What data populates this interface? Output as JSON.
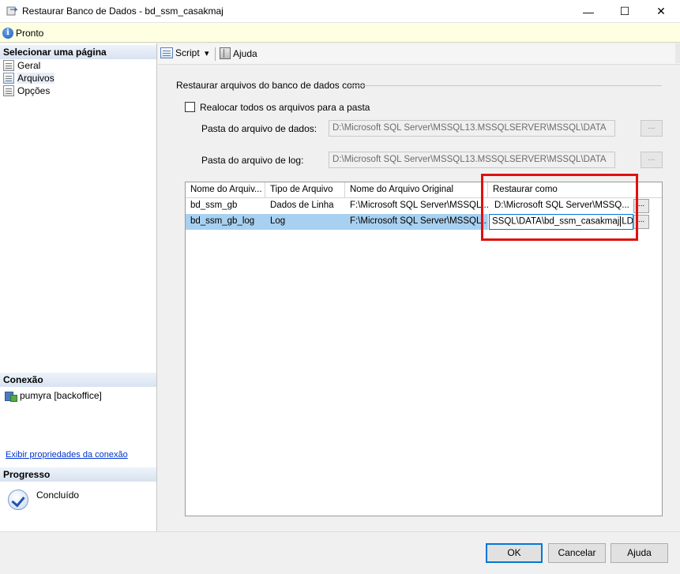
{
  "window": {
    "title": "Restaurar Banco de Dados - bd_ssm_casakmaj",
    "minimize": "—",
    "maximize": "☐",
    "close": "✕"
  },
  "status": {
    "text": "Pronto"
  },
  "sidebar": {
    "select_page_header": "Selecionar uma página",
    "items": [
      {
        "label": "Geral"
      },
      {
        "label": "Arquivos"
      },
      {
        "label": "Opções"
      }
    ],
    "connection_header": "Conexão",
    "connection_name": "pumyra [backoffice]",
    "connection_link": "Exibir propriedades da conexão",
    "progress_header": "Progresso",
    "progress_status": "Concluído"
  },
  "toolbar": {
    "script_label": "Script",
    "dropdown_arrow": "▾",
    "help_label": "Ajuda"
  },
  "restore_group": {
    "title": "Restaurar arquivos do banco de dados como",
    "relocate_label": "Realocar todos os arquivos para a pasta",
    "relocate_checked": false,
    "data_folder_label": "Pasta do arquivo de dados:",
    "data_folder_value": "D:\\Microsoft SQL Server\\MSSQL13.MSSQLSERVER\\MSSQL\\DATA",
    "log_folder_label": "Pasta do arquivo de log:",
    "log_folder_value": "D:\\Microsoft SQL Server\\MSSQL13.MSSQLSERVER\\MSSQL\\DATA",
    "browse_label": "..."
  },
  "grid": {
    "columns": [
      "Nome do Arquiv...",
      "Tipo de Arquivo",
      "Nome do Arquivo Original",
      "Restaurar como"
    ],
    "rows": [
      {
        "logical_name": "bd_ssm_gb",
        "type": "Dados de Linha",
        "original": "F:\\Microsoft SQL Server\\MSSQL...",
        "restore_as": "D:\\Microsoft SQL Server\\MSSQ..."
      },
      {
        "logical_name": "bd_ssm_gb_log",
        "type": "Log",
        "original": "F:\\Microsoft SQL Server\\MSSQL...",
        "restore_as_before_caret": "SSQL\\DATA\\bd_ssm_casakmaj",
        "restore_as_after_caret": "LDI"
      }
    ],
    "cell_button_label": "..."
  },
  "buttons": {
    "ok": "OK",
    "cancel": "Cancelar",
    "help": "Ajuda"
  },
  "colors": {
    "highlight_box": "#e01010",
    "selected_row": "#a8d0f0",
    "status_bar": "#ffffe1",
    "link": "#0033cc"
  }
}
